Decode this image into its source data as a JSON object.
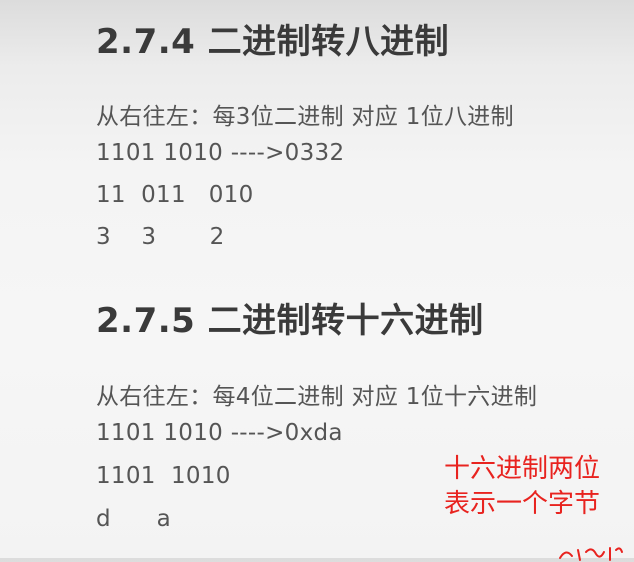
{
  "section1": {
    "heading": "2.7.4 二进制转八进制",
    "lines": [
      "从右往左：每3位二进制 对应 1位八进制",
      "1101 1010 ---->0332",
      "11  011   010",
      "3    3       2"
    ]
  },
  "section2": {
    "heading": "2.7.5 二进制转十六进制",
    "lines": [
      "从右往左：每4位二进制 对应 1位十六进制",
      "1101 1010 ---->0xda",
      "1101  1010",
      "d      a"
    ]
  },
  "annotation": {
    "line1": "十六进制两位",
    "line2": "表示一个字节",
    "color": "#e8231f"
  }
}
